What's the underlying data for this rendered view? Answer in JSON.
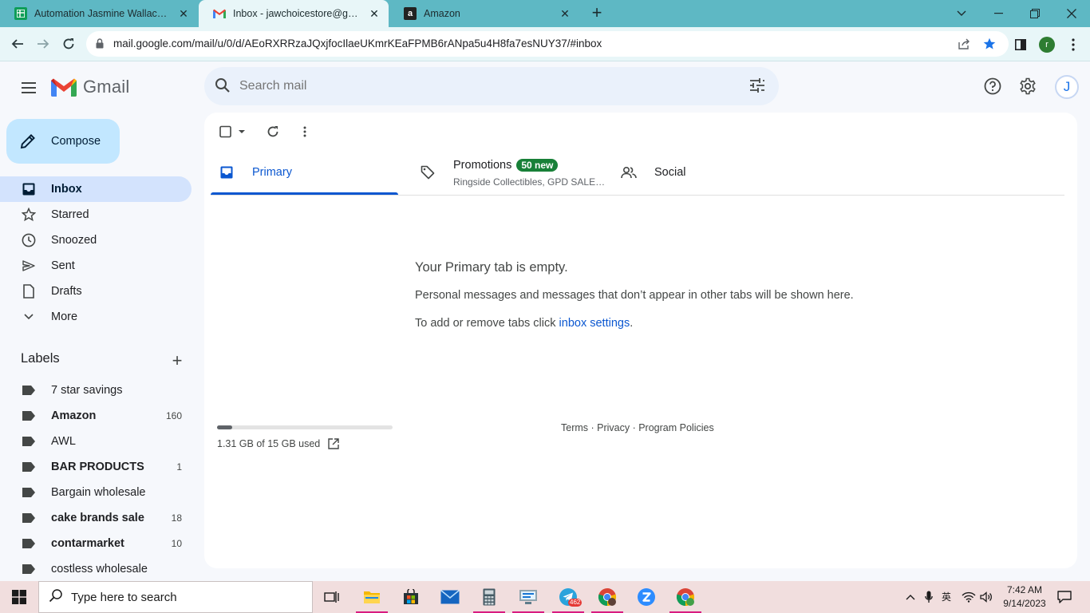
{
  "browser": {
    "tabs": [
      {
        "title": "Automation Jasmine Wallace - Go",
        "favicon": "sheets-icon",
        "color": "#0f9d58"
      },
      {
        "title": "Inbox - jawchoicestore@gmail.com",
        "favicon": "gmail-icon",
        "color": "#ea4335"
      },
      {
        "title": "Amazon",
        "favicon": "amazon-icon",
        "color": "#222222"
      }
    ],
    "url": "mail.google.com/mail/u/0/d/AEoRXRRzaJQxjfocIlaeUKmrKEaFPMB6rANpa5u4H8fa7esNUY37/#inbox",
    "profile_initial": "r"
  },
  "gmail": {
    "wordmark": "Gmail",
    "search_placeholder": "Search mail",
    "avatar_initial": "J",
    "compose_label": "Compose",
    "nav": [
      {
        "label": "Inbox",
        "icon": "inbox-icon",
        "active": true
      },
      {
        "label": "Starred",
        "icon": "star-icon"
      },
      {
        "label": "Snoozed",
        "icon": "clock-icon"
      },
      {
        "label": "Sent",
        "icon": "send-icon"
      },
      {
        "label": "Drafts",
        "icon": "draft-icon"
      },
      {
        "label": "More",
        "icon": "chevron-down-icon"
      }
    ],
    "labels_heading": "Labels",
    "labels": [
      {
        "name": "7 star savings",
        "count": "",
        "bold": false
      },
      {
        "name": "Amazon",
        "count": "160",
        "bold": true
      },
      {
        "name": "AWL",
        "count": "",
        "bold": false
      },
      {
        "name": "BAR PRODUCTS",
        "count": "1",
        "bold": true
      },
      {
        "name": "Bargain wholesale",
        "count": "",
        "bold": false
      },
      {
        "name": "cake brands sale",
        "count": "18",
        "bold": true
      },
      {
        "name": "contarmarket",
        "count": "10",
        "bold": true
      },
      {
        "name": "costless wholesale",
        "count": "",
        "bold": false
      }
    ],
    "categories": {
      "primary": "Primary",
      "promotions": "Promotions",
      "promotions_badge": "50 new",
      "promotions_sub": "Ringside Collectibles, GPD SALE…",
      "social": "Social"
    },
    "empty": {
      "title": "Your Primary tab is empty.",
      "text": "Personal messages and messages that don’t appear in other tabs will be shown here.",
      "settings_prefix": "To add or remove tabs click ",
      "settings_link": "inbox settings",
      "settings_suffix": "."
    },
    "storage": {
      "text": "1.31 GB of 15 GB used",
      "fraction": 0.087
    },
    "footer": "Terms · Privacy · Program Policies"
  },
  "taskbar": {
    "search_placeholder": "Type here to search",
    "telegram_badge": "462",
    "time": "7:42 AM",
    "date": "9/14/2023"
  }
}
